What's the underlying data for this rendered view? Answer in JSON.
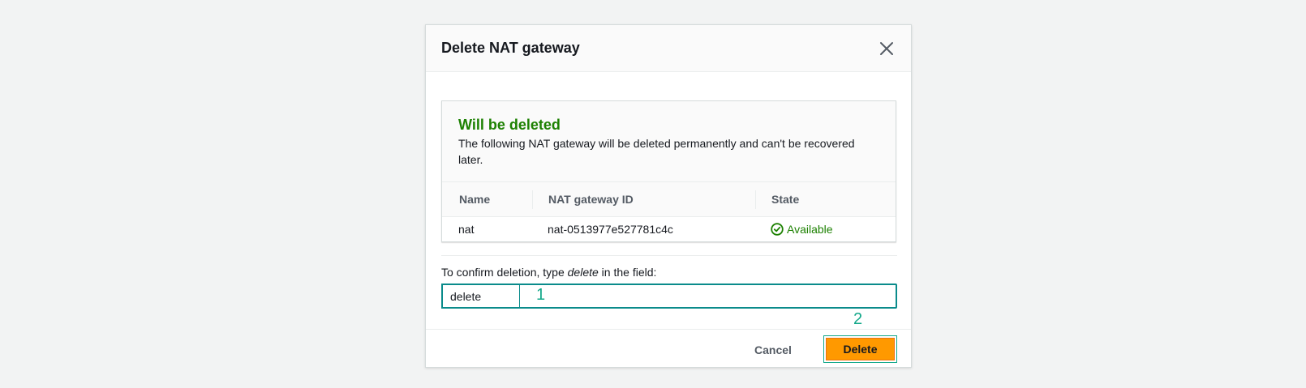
{
  "modal": {
    "title": "Delete NAT gateway",
    "close_icon": "close-icon"
  },
  "container": {
    "title": "Will be deleted",
    "description": "The following NAT gateway will be deleted permanently and can't be recovered later."
  },
  "table": {
    "columns": [
      "Name",
      "NAT gateway ID",
      "State"
    ],
    "rows": [
      {
        "name": "nat",
        "id": "nat-0513977e527781c4c",
        "state": "Available",
        "state_icon": "check-circle-icon"
      }
    ]
  },
  "confirm": {
    "label_before": "To confirm deletion, type ",
    "label_keyword": "delete",
    "label_after": " in the field:",
    "input_value": "delete"
  },
  "footer": {
    "cancel_label": "Cancel",
    "delete_label": "Delete"
  },
  "annotations": {
    "marker_1": "1",
    "marker_2": "2"
  },
  "colors": {
    "success": "#1d8102",
    "primary_button": "#ff9900",
    "focus": "#0a8b8b"
  }
}
